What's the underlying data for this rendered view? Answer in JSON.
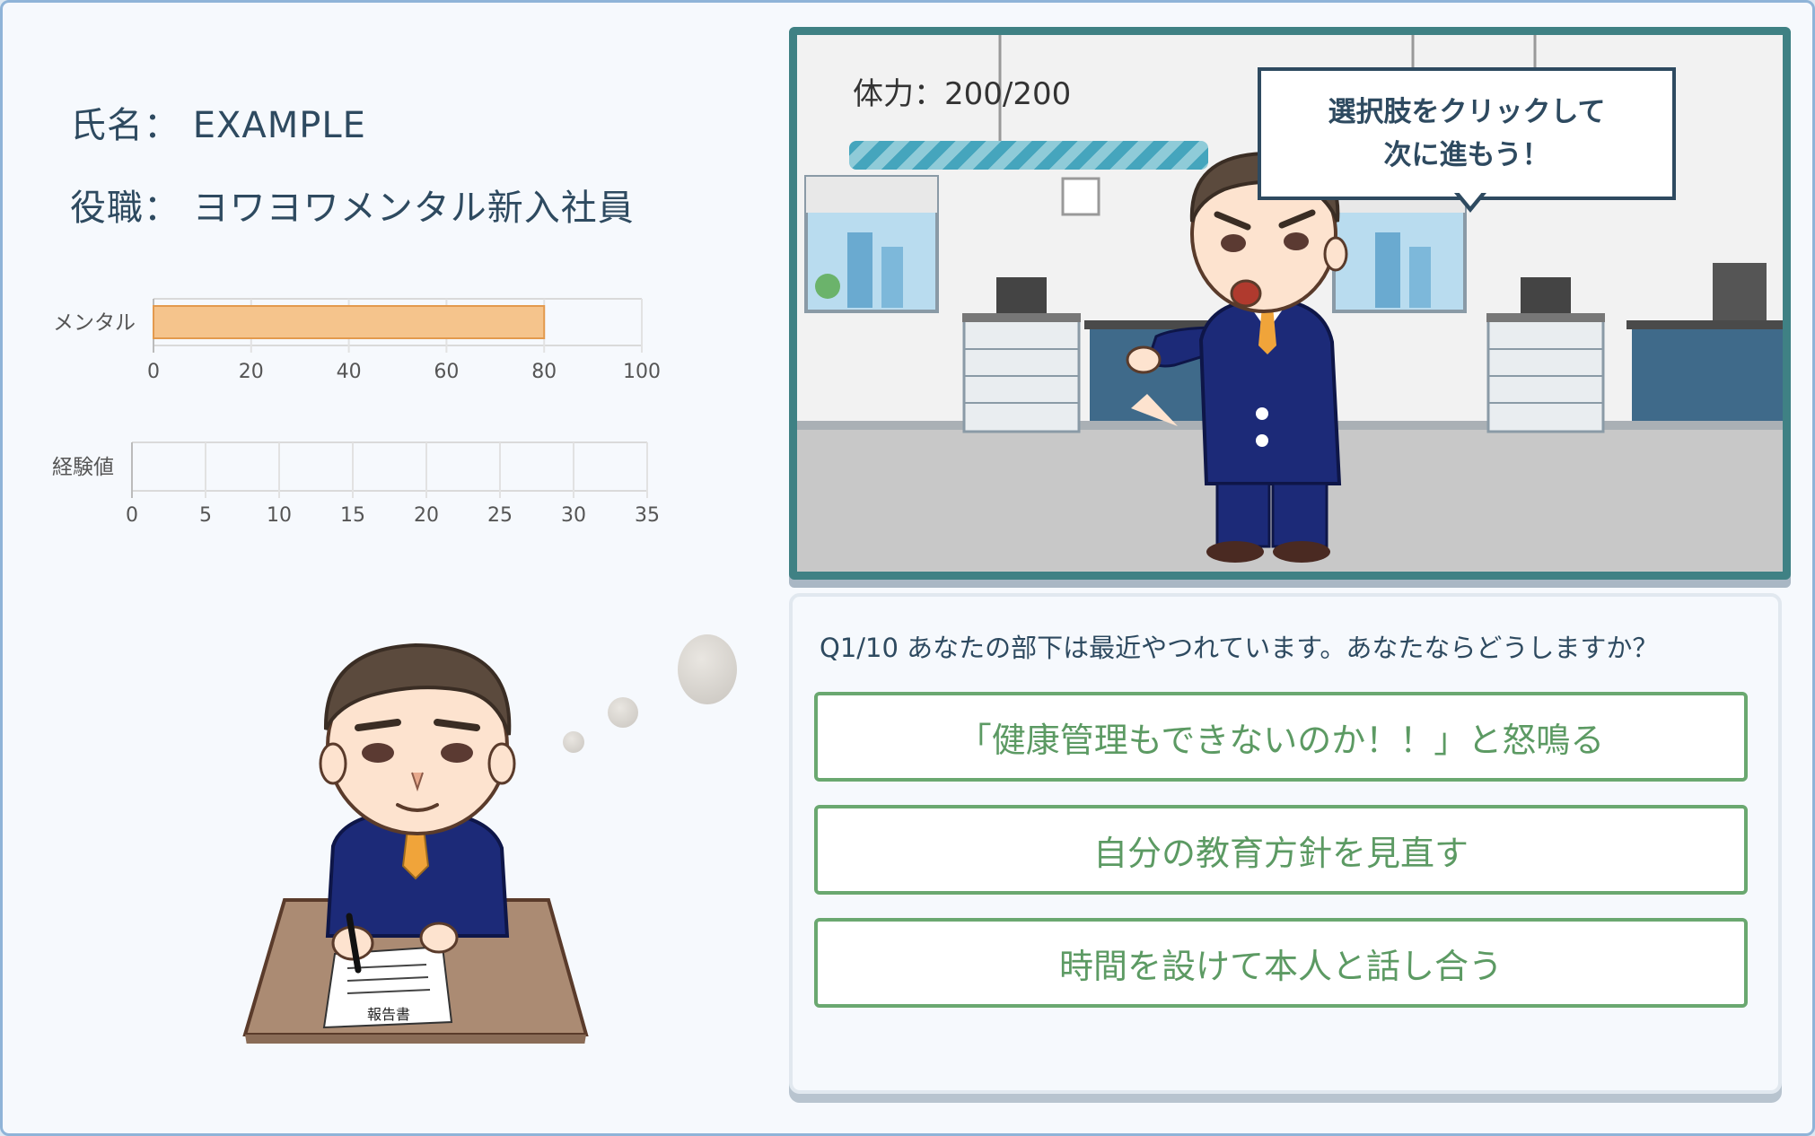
{
  "profile": {
    "name_label": "氏名：",
    "name_value": "EXAMPLE",
    "role_label": "役職：",
    "role_value": "ヨワヨワメンタル新入社員"
  },
  "chart_data": [
    {
      "type": "bar",
      "orientation": "horizontal",
      "categories": [
        "メンタル"
      ],
      "values": [
        80
      ],
      "xlim": [
        0,
        100
      ],
      "ticks": [
        0,
        20,
        40,
        60,
        80,
        100
      ],
      "color": "#f5c48c",
      "grid": true
    },
    {
      "type": "bar",
      "orientation": "horizontal",
      "categories": [
        "経験値"
      ],
      "values": [
        0
      ],
      "xlim": [
        0,
        35
      ],
      "ticks": [
        0,
        5,
        10,
        15,
        20,
        25,
        30,
        35
      ],
      "color": "#f5c48c",
      "grid": true
    }
  ],
  "scene": {
    "hp_text": "体力：200/200",
    "hp": {
      "current": 200,
      "max": 200
    },
    "bubble_line1": "選択肢をクリックして",
    "bubble_line2": "次に進もう！"
  },
  "quiz": {
    "question": "Q1/10 あなたの部下は最近やつれています。あなたならどうしますか？",
    "choices": [
      "「健康管理もできないのか！！」と怒鳴る",
      "自分の教育方針を見直す",
      "時間を設けて本人と話し合う"
    ]
  },
  "illustration": {
    "document_text": "報告書"
  },
  "colors": {
    "accent": "#3f8184",
    "choice_border": "#6aa870",
    "bar_fill": "#f5c48c",
    "suit": "#1c2a78"
  }
}
